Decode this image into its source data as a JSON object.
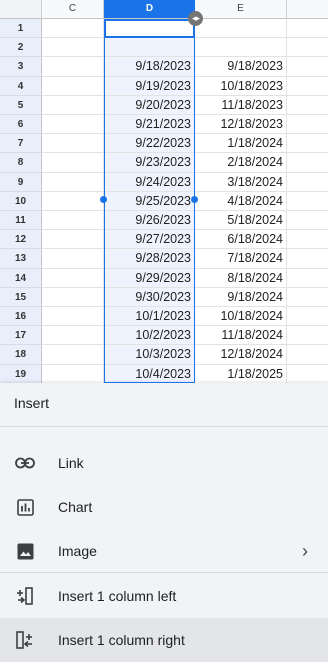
{
  "columns": {
    "c": "C",
    "d": "D",
    "e": "E"
  },
  "resize_glyph": "◂▸",
  "rows": [
    {
      "num": "1",
      "d": "",
      "e": ""
    },
    {
      "num": "2",
      "d": "",
      "e": ""
    },
    {
      "num": "3",
      "d": "9/18/2023",
      "e": "9/18/2023"
    },
    {
      "num": "4",
      "d": "9/19/2023",
      "e": "10/18/2023"
    },
    {
      "num": "5",
      "d": "9/20/2023",
      "e": "11/18/2023"
    },
    {
      "num": "6",
      "d": "9/21/2023",
      "e": "12/18/2023"
    },
    {
      "num": "7",
      "d": "9/22/2023",
      "e": "1/18/2024"
    },
    {
      "num": "8",
      "d": "9/23/2023",
      "e": "2/18/2024"
    },
    {
      "num": "9",
      "d": "9/24/2023",
      "e": "3/18/2024"
    },
    {
      "num": "10",
      "d": "9/25/2023",
      "e": "4/18/2024"
    },
    {
      "num": "11",
      "d": "9/26/2023",
      "e": "5/18/2024"
    },
    {
      "num": "12",
      "d": "9/27/2023",
      "e": "6/18/2024"
    },
    {
      "num": "13",
      "d": "9/28/2023",
      "e": "7/18/2024"
    },
    {
      "num": "14",
      "d": "9/29/2023",
      "e": "8/18/2024"
    },
    {
      "num": "15",
      "d": "9/30/2023",
      "e": "9/18/2024"
    },
    {
      "num": "16",
      "d": "10/1/2023",
      "e": "10/18/2024"
    },
    {
      "num": "17",
      "d": "10/2/2023",
      "e": "11/18/2024"
    },
    {
      "num": "18",
      "d": "10/3/2023",
      "e": "12/18/2024"
    },
    {
      "num": "19",
      "d": "10/4/2023",
      "e": "1/18/2025"
    }
  ],
  "menu": {
    "title": "Insert",
    "items": [
      {
        "label": "Link",
        "icon": "link-icon"
      },
      {
        "label": "Chart",
        "icon": "chart-icon"
      },
      {
        "label": "Image",
        "icon": "image-icon",
        "submenu": "›"
      },
      {
        "label": "Insert 1 column left",
        "icon": "insert-column-left-icon"
      },
      {
        "label": "Insert 1 column right",
        "icon": "insert-column-right-icon"
      }
    ]
  },
  "colors": {
    "accent": "#1a73e8",
    "selection_fill": "#eef3fd",
    "row_header": "#e8eefa"
  }
}
